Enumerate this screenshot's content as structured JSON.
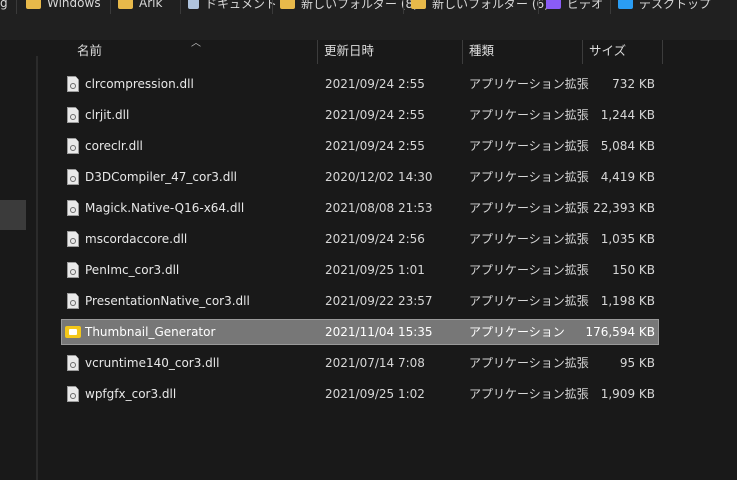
{
  "quick_access": [
    {
      "label": "g",
      "icon": "text-fragment",
      "color": ""
    },
    {
      "label": "Windows",
      "icon": "folder-icon",
      "color": "#e8b94a"
    },
    {
      "label": "Arik",
      "icon": "folder-icon",
      "color": "#e8b94a"
    },
    {
      "label": "ドキュメント",
      "icon": "document-icon",
      "color": "#b0c4de"
    },
    {
      "label": "新しいフォルダー (8)",
      "icon": "folder-icon",
      "color": "#e8b94a"
    },
    {
      "label": "新しいフォルダー (6)",
      "icon": "folder-icon",
      "color": "#e8b94a"
    },
    {
      "label": "ビデオ",
      "icon": "video-icon",
      "color": "#8a5cf6"
    },
    {
      "label": "デスクトップ",
      "icon": "desktop-icon",
      "color": "#2a9df4"
    }
  ],
  "columns": {
    "name": "名前",
    "date": "更新日時",
    "type": "種類",
    "size": "サイズ"
  },
  "sort": {
    "column": "name",
    "icon": "sort-up-icon"
  },
  "files": [
    {
      "name": "clrcompression.dll",
      "date": "2021/09/24 2:55",
      "type": "アプリケーション拡張",
      "size": "732 KB",
      "icon": "dll-file-icon",
      "selected": false
    },
    {
      "name": "clrjit.dll",
      "date": "2021/09/24 2:55",
      "type": "アプリケーション拡張",
      "size": "1,244 KB",
      "icon": "dll-file-icon",
      "selected": false
    },
    {
      "name": "coreclr.dll",
      "date": "2021/09/24 2:55",
      "type": "アプリケーション拡張",
      "size": "5,084 KB",
      "icon": "dll-file-icon",
      "selected": false
    },
    {
      "name": "D3DCompiler_47_cor3.dll",
      "date": "2020/12/02 14:30",
      "type": "アプリケーション拡張",
      "size": "4,419 KB",
      "icon": "dll-file-icon",
      "selected": false
    },
    {
      "name": "Magick.Native-Q16-x64.dll",
      "date": "2021/08/08 21:53",
      "type": "アプリケーション拡張",
      "size": "22,393 KB",
      "icon": "dll-file-icon",
      "selected": false
    },
    {
      "name": "mscordaccore.dll",
      "date": "2021/09/24 2:56",
      "type": "アプリケーション拡張",
      "size": "1,035 KB",
      "icon": "dll-file-icon",
      "selected": false
    },
    {
      "name": "PenImc_cor3.dll",
      "date": "2021/09/25 1:01",
      "type": "アプリケーション拡張",
      "size": "150 KB",
      "icon": "dll-file-icon",
      "selected": false
    },
    {
      "name": "PresentationNative_cor3.dll",
      "date": "2021/09/22 23:57",
      "type": "アプリケーション拡張",
      "size": "1,198 KB",
      "icon": "dll-file-icon",
      "selected": false
    },
    {
      "name": "Thumbnail_Generator",
      "date": "2021/11/04 15:35",
      "type": "アプリケーション",
      "size": "176,594 KB",
      "icon": "exe-file-icon",
      "selected": true
    },
    {
      "name": "vcruntime140_cor3.dll",
      "date": "2021/07/14 7:08",
      "type": "アプリケーション拡張",
      "size": "95 KB",
      "icon": "dll-file-icon",
      "selected": false
    },
    {
      "name": "wpfgfx_cor3.dll",
      "date": "2021/09/25 1:02",
      "type": "アプリケーション拡張",
      "size": "1,909 KB",
      "icon": "dll-file-icon",
      "selected": false
    }
  ]
}
